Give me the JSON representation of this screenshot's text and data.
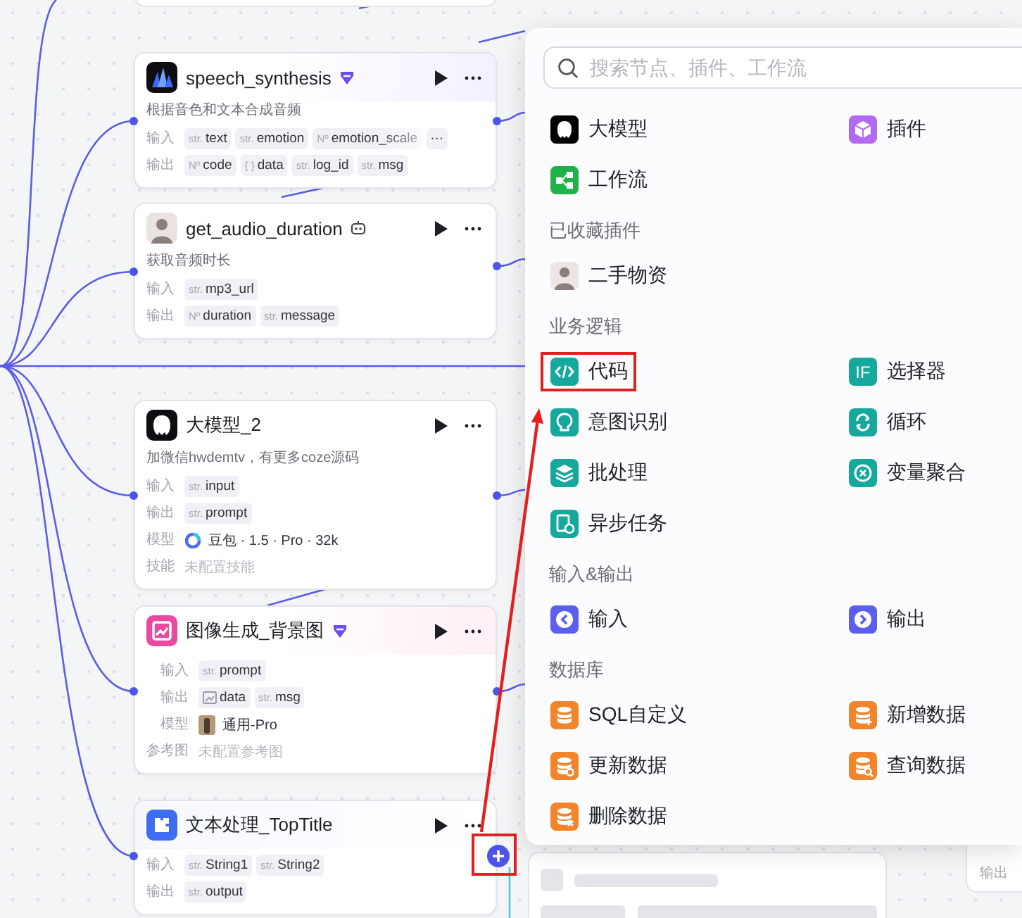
{
  "nodes": [
    {
      "kind": "speech",
      "title": "speech_synthesis",
      "description": "根据音色和文本合成音频",
      "rows": [
        {
          "kind": "params",
          "label": "输入",
          "tags": [
            {
              "kind": "text",
              "prefix": "str.",
              "name": "text",
              "faded": false
            },
            {
              "kind": "text",
              "prefix": "str.",
              "name": "emotion",
              "faded": false
            },
            {
              "kind": "text",
              "prefix": "Nº",
              "name": "emotion_scale",
              "faded": true
            },
            {
              "kind": "more",
              "name": "···",
              "faded": false
            }
          ]
        },
        {
          "kind": "params",
          "label": "输出",
          "tags": [
            {
              "kind": "text",
              "prefix": "Nº",
              "name": "code",
              "faded": false
            },
            {
              "kind": "text",
              "prefix": "{ }",
              "name": "data",
              "faded": false
            },
            {
              "kind": "text",
              "prefix": "str.",
              "name": "log_id",
              "faded": false
            },
            {
              "kind": "text",
              "prefix": "str.",
              "name": "msg",
              "faded": false
            }
          ]
        }
      ]
    },
    {
      "kind": "avatar",
      "title": "get_audio_duration",
      "description": "获取音频时长",
      "rows": [
        {
          "kind": "params",
          "label": "输入",
          "tags": [
            {
              "kind": "text",
              "prefix": "str.",
              "name": "mp3_url",
              "faded": false
            }
          ]
        },
        {
          "kind": "params",
          "label": "输出",
          "tags": [
            {
              "kind": "text",
              "prefix": "Nº",
              "name": "duration",
              "faded": false
            },
            {
              "kind": "text",
              "prefix": "str.",
              "name": "message",
              "faded": false
            }
          ]
        }
      ]
    },
    {
      "kind": "llm",
      "title": "大模型_2",
      "description": "加微信hwdemtv，有更多coze源码",
      "rows": [
        {
          "kind": "params",
          "label": "输入",
          "tags": [
            {
              "kind": "text",
              "prefix": "str.",
              "name": "input",
              "faded": false
            }
          ]
        },
        {
          "kind": "params",
          "label": "输出",
          "tags": [
            {
              "kind": "text",
              "prefix": "str.",
              "name": "prompt",
              "faded": false
            }
          ]
        },
        {
          "kind": "model",
          "label": "模型",
          "value": "豆包 · 1.5 · Pro · 32k"
        },
        {
          "kind": "note",
          "label": "技能",
          "value": "未配置技能"
        }
      ]
    },
    {
      "kind": "image",
      "title": "图像生成_背景图",
      "rows": [
        {
          "kind": "params",
          "label": "输入",
          "tags": [
            {
              "kind": "text",
              "prefix": "str.",
              "name": "prompt",
              "faded": false
            }
          ]
        },
        {
          "kind": "params",
          "label": "输出",
          "tags": [
            {
              "kind": "image",
              "name": "data",
              "faded": false
            },
            {
              "kind": "text",
              "prefix": "str.",
              "name": "msg",
              "faded": false
            }
          ]
        },
        {
          "kind": "model",
          "label": "模型",
          "value": "通用-Pro"
        },
        {
          "kind": "note",
          "label": "参考图",
          "value": "未配置参考图"
        }
      ]
    },
    {
      "kind": "text",
      "title": "文本处理_TopTitle",
      "rows": [
        {
          "kind": "params",
          "label": "输入",
          "tags": [
            {
              "kind": "text",
              "prefix": "str.",
              "name": "String1",
              "faded": false
            },
            {
              "kind": "text",
              "prefix": "str.",
              "name": "String2",
              "faded": false
            }
          ]
        },
        {
          "kind": "params",
          "label": "输出",
          "tags": [
            {
              "kind": "text",
              "prefix": "str.",
              "name": "output",
              "faded": false
            }
          ]
        }
      ]
    }
  ],
  "add_button": {
    "highlighted": true
  },
  "annotation": {
    "arrow": true
  },
  "partial_node": {
    "label": "输出"
  },
  "menu": {
    "search": {
      "placeholder": "搜索节点、插件、工作流"
    },
    "sections": [
      {
        "items": [
          {
            "kind": "llm",
            "label": "大模型",
            "color": "#000000",
            "highlighted": false
          },
          {
            "kind": "plugin",
            "label": "插件",
            "color": "#b36af2",
            "highlighted": false
          },
          {
            "kind": "workflow",
            "label": "工作流",
            "color": "#1fb24a",
            "highlighted": false
          }
        ]
      },
      {
        "title": "已收藏插件",
        "items": [
          {
            "kind": "avatar",
            "label": "二手物资",
            "highlighted": false
          }
        ]
      },
      {
        "title": "业务逻辑",
        "items": [
          {
            "kind": "code",
            "label": "代码",
            "color": "#16a79d",
            "highlighted": true
          },
          {
            "kind": "selector",
            "label": "选择器",
            "color": "#16a79d",
            "icon_text": "IF",
            "highlighted": false
          },
          {
            "kind": "intent",
            "label": "意图识别",
            "color": "#16a79d",
            "highlighted": false
          },
          {
            "kind": "loop",
            "label": "循环",
            "color": "#16a79d",
            "highlighted": false
          },
          {
            "kind": "batch",
            "label": "批处理",
            "color": "#16a79d",
            "highlighted": false
          },
          {
            "kind": "aggregate",
            "label": "变量聚合",
            "color": "#16a79d",
            "highlighted": false
          },
          {
            "kind": "async",
            "label": "异步任务",
            "color": "#16a79d",
            "highlighted": false
          }
        ]
      },
      {
        "title": "输入&输出",
        "items": [
          {
            "kind": "input",
            "label": "输入",
            "color": "#5a5ff0",
            "highlighted": false
          },
          {
            "kind": "output",
            "label": "输出",
            "color": "#5a5ff0",
            "highlighted": false
          }
        ]
      },
      {
        "title": "数据库",
        "items": [
          {
            "kind": "sql",
            "label": "SQL自定义",
            "color": "#f2852c",
            "highlighted": false
          },
          {
            "kind": "insert",
            "label": "新增数据",
            "color": "#f2852c",
            "highlighted": false
          },
          {
            "kind": "update",
            "label": "更新数据",
            "color": "#f2852c",
            "highlighted": false
          },
          {
            "kind": "query",
            "label": "查询数据",
            "color": "#f2852c",
            "highlighted": false
          },
          {
            "kind": "delete",
            "label": "删除数据",
            "color": "#f2852c",
            "highlighted": false
          }
        ]
      }
    ]
  }
}
